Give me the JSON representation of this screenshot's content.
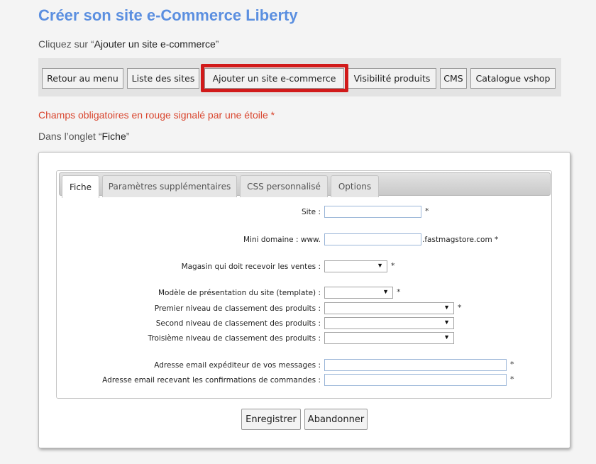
{
  "header": {
    "title": "Créer son site e-Commerce Liberty",
    "instruction1_prefix": "Cliquez sur “",
    "instruction1_target": "Ajouter un site e-commerce",
    "instruction1_suffix": "”",
    "required_note": "Champs obligatoires en rouge signalé par une étoile *",
    "instruction2_prefix": "Dans l’onglet “",
    "instruction2_target": "Fiche",
    "instruction2_suffix": "”"
  },
  "menu": {
    "items": [
      "Retour au menu",
      "Liste des sites",
      "Ajouter un site e-commerce",
      "Visibilité produits",
      "CMS",
      "Catalogue vshop"
    ],
    "highlight_color": "#d11a1a"
  },
  "tabs": [
    "Fiche",
    "Paramètres supplémentaires",
    "CSS personnalisé",
    "Options"
  ],
  "form": {
    "site_label": "Site :",
    "mini_domain_label": "Mini domaine : www.",
    "mini_domain_suffix": ".fastmagstore.com *",
    "store_label": "Magasin qui doit recevoir les ventes :",
    "template_label": "Modèle de présentation du site (template) :",
    "level1_label": "Premier niveau de classement des produits :",
    "level2_label": "Second niveau de classement des produits :",
    "level3_label": "Troisième niveau de classement des produits :",
    "sender_email_label": "Adresse email expéditeur de vos messages :",
    "confirm_email_label": "Adresse email recevant les confirmations de commandes :",
    "required_mark": "*",
    "dropdown_arrow": "▼"
  },
  "actions": {
    "save": "Enregistrer",
    "cancel": "Abandonner"
  },
  "colors": {
    "title": "#5b8fe0",
    "required_note": "#d9462f"
  }
}
